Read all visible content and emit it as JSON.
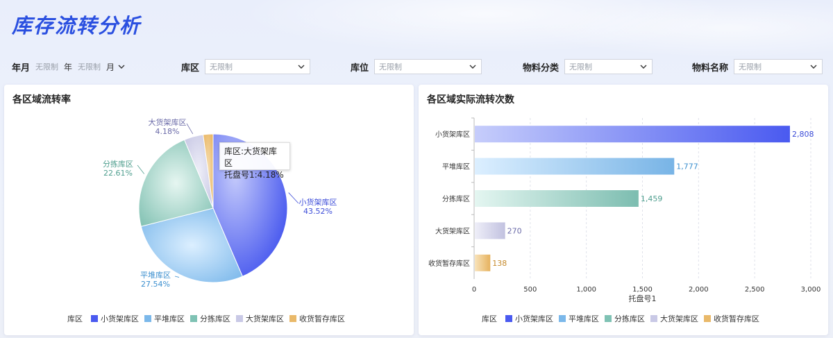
{
  "page": {
    "title": "库存流转分析"
  },
  "filters": {
    "year_month": {
      "label": "年月",
      "year_value": "无限制",
      "year_unit": "年",
      "month_value": "无限制",
      "month_unit": "月"
    },
    "area": {
      "label": "库区",
      "value": "无限制"
    },
    "location": {
      "label": "库位",
      "value": "无限制"
    },
    "category": {
      "label": "物料分类",
      "value": "无限制"
    },
    "material": {
      "label": "物料名称",
      "value": "无限制"
    }
  },
  "pie_panel": {
    "title": "各区域流转率",
    "legend_title": "库区",
    "tooltip": {
      "line1": "库区:大货架库区",
      "line2": "托盘号1:4.18%"
    }
  },
  "bar_panel": {
    "title": "各区域实际流转次数",
    "legend_title": "库区"
  },
  "colors": {
    "小货架库区": "#4a5af0",
    "平堆库区": "#7bb8ea",
    "分拣库区": "#7fc2b4",
    "大货架库区": "#c9c9e6",
    "收货暂存库区": "#e9b96a"
  },
  "chart_data": [
    {
      "type": "pie",
      "title": "各区域流转率",
      "categories": [
        "小货架库区",
        "平堆库区",
        "分拣库区",
        "大货架库区",
        "收货暂存库区"
      ],
      "values": [
        43.52,
        27.54,
        22.61,
        4.18,
        2.15
      ],
      "labels": [
        "43.52%",
        "27.54%",
        "22.61%",
        "4.18%",
        ""
      ],
      "legend": [
        "小货架库区",
        "平堆库区",
        "分拣库区",
        "大货架库区",
        "收货暂存库区"
      ]
    },
    {
      "type": "bar",
      "orientation": "horizontal",
      "title": "各区域实际流转次数",
      "categories": [
        "小货架库区",
        "平堆库区",
        "分拣库区",
        "大货架库区",
        "收货暂存库区"
      ],
      "values": [
        2808,
        1777,
        1459,
        270,
        138
      ],
      "value_labels": [
        "2,808",
        "1,777",
        "1,459",
        "270",
        "138"
      ],
      "xlabel": "托盘号1",
      "xlim": [
        0,
        3000
      ],
      "xticks": [
        "0",
        "500",
        "1,000",
        "1,500",
        "2,000",
        "2,500",
        "3,000"
      ],
      "grid": true,
      "legend": [
        "小货架库区",
        "平堆库区",
        "分拣库区",
        "大货架库区",
        "收货暂存库区"
      ]
    }
  ]
}
